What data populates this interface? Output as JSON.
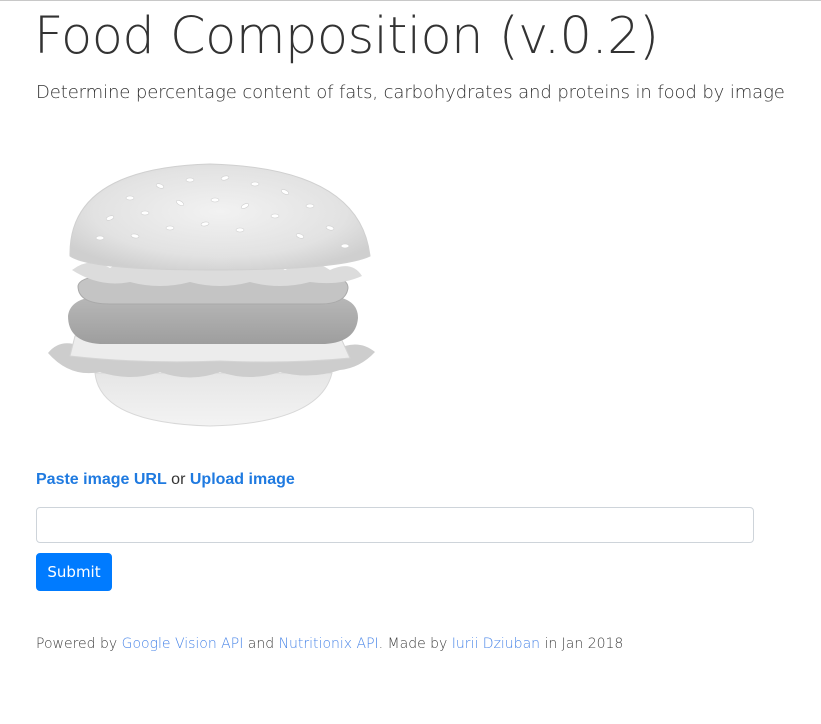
{
  "header": {
    "title": "Food Composition (v.0.2)",
    "subtitle": "Determine percentage content of fats, carbohydrates and proteins in food by image"
  },
  "preview": {
    "image": "burger-image"
  },
  "source": {
    "paste_link": "Paste image URL",
    "separator": "or",
    "upload_link": "Upload image"
  },
  "form": {
    "url_value": "",
    "submit_label": "Submit"
  },
  "footer": {
    "powered_by": "Powered by",
    "link_google": "Google Vision API",
    "and": "and",
    "link_nutritionix": "Nutritionix API",
    "made_by": ". Made by",
    "link_author": "Iurii Dziuban",
    "date_text": "in Jan 2018"
  },
  "colors": {
    "primary": "#007bff",
    "link": "#1f7ae0",
    "footer_link": "#4a86e8",
    "text": "#333333"
  }
}
